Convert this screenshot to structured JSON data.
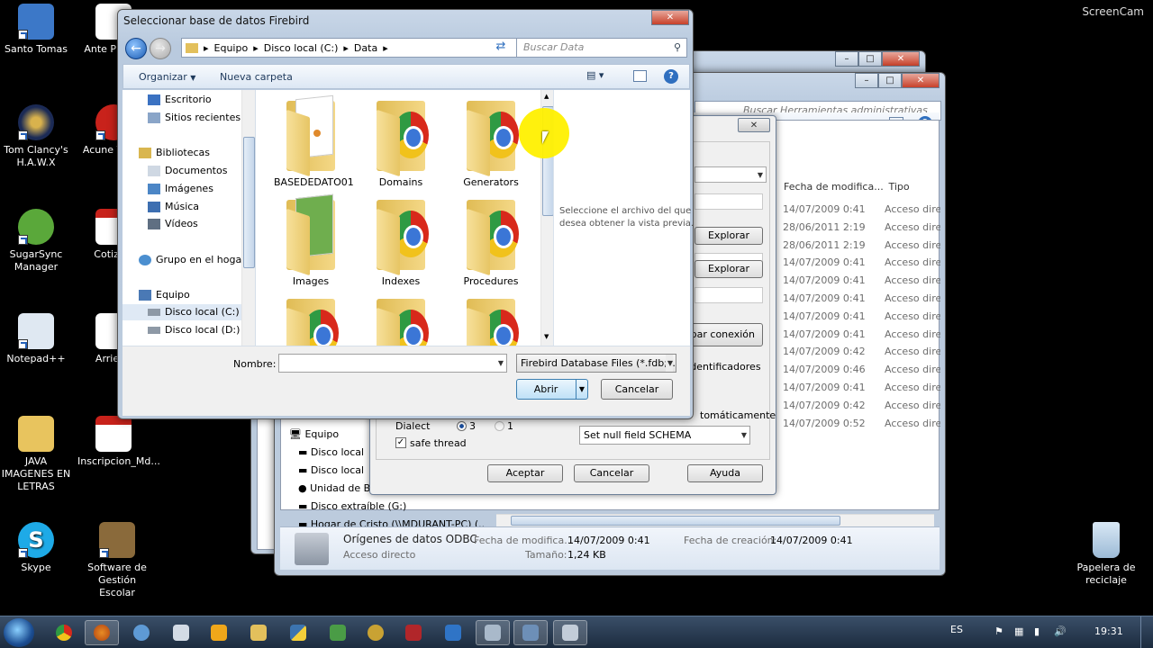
{
  "desktop": {
    "icons": [
      {
        "label": "Santo Tomas",
        "icon": "computer-icon",
        "color": "#3c78c8"
      },
      {
        "label": "Tom Clancy's H.A.W.X",
        "icon": "game-icon",
        "color": "#1b2a55"
      },
      {
        "label": "SugarSync Manager",
        "icon": "sugarsync-icon",
        "color": "#5aa83a"
      },
      {
        "label": "Notepad++",
        "icon": "notepad-icon",
        "color": "#dfe8f2"
      },
      {
        "label": "JAVA IMAGENES EN LETRAS",
        "icon": "folder-icon",
        "color": "#e8c45e"
      },
      {
        "label": "Skype",
        "icon": "skype-icon",
        "color": "#1eaae7"
      },
      {
        "label": "Ante P Tesis",
        "icon": "document-icon",
        "color": "#ffffff"
      },
      {
        "label": "Acune Vulne",
        "icon": "app-icon",
        "color": "#c8221b"
      },
      {
        "label": "Cotizaci",
        "icon": "pdf-icon",
        "color": "#c8221b"
      },
      {
        "label": "Arriend",
        "icon": "document-icon",
        "color": "#ffffff"
      },
      {
        "label": "Inscripcion_Md...",
        "icon": "pdf-icon",
        "color": "#c8221b"
      },
      {
        "label": "Software de Gestión Escolar",
        "icon": "school-icon",
        "color": "#8a6a3b"
      },
      {
        "label": "Papelera de reciclaje",
        "icon": "recycle-bin-icon",
        "color": "#b9d3ea"
      }
    ],
    "screencam": "ScreenCam"
  },
  "back_explorer": {
    "search_placeholder": "Buscar Herramientas administrativas",
    "columns": [
      "Fecha de modifica...",
      "Tipo"
    ],
    "rows": [
      {
        "date": "14/07/2009 0:41",
        "type": "Acceso direc"
      },
      {
        "date": "28/06/2011 2:19",
        "type": "Acceso direc"
      },
      {
        "date": "28/06/2011 2:19",
        "type": "Acceso direc"
      },
      {
        "date": "14/07/2009 0:41",
        "type": "Acceso direc"
      },
      {
        "date": "14/07/2009 0:41",
        "type": "Acceso direc"
      },
      {
        "date": "14/07/2009 0:41",
        "type": "Acceso direc"
      },
      {
        "date": "14/07/2009 0:41",
        "type": "Acceso direc"
      },
      {
        "date": "14/07/2009 0:41",
        "type": "Acceso direc"
      },
      {
        "date": "14/07/2009 0:42",
        "type": "Acceso direc"
      },
      {
        "date": "14/07/2009 0:46",
        "type": "Acceso direc"
      },
      {
        "date": "14/07/2009 0:41",
        "type": "Acceso direc"
      },
      {
        "date": "14/07/2009 0:42",
        "type": "Acceso direc"
      },
      {
        "date": "14/07/2009 0:52",
        "type": "Acceso direc"
      }
    ],
    "nav": [
      "Equipo",
      "Disco local",
      "Disco local",
      "Unidad de B",
      "Disco extraíble (G:)",
      "Hogar de Cristo (\\\\MDURANT-PC) (..."
    ],
    "details": {
      "name": "Orígenes de datos ODBC",
      "mod_label": "Fecha de modifica...",
      "mod_value": "14/07/2009 0:41",
      "created_label": "Fecha de creación:",
      "created_value": "14/07/2009 0:41",
      "type": "Acceso directo",
      "size_label": "Tamaño:",
      "size_value": "1,24 KB"
    }
  },
  "cfg_dialog": {
    "explore1": "Explorar",
    "explore2": "Explorar",
    "test_conn": "bar conexión",
    "quoted_ids": "Identificadores",
    "auto": "tomáticamente",
    "dialect_label": "Dialect",
    "dialect_3": "3",
    "dialect_1": "1",
    "safe_thread": "safe thread",
    "null_field": "Set null field SCHEMA",
    "ok": "Aceptar",
    "cancel": "Cancelar",
    "help": "Ayuda"
  },
  "file_dialog": {
    "title": "Seleccionar base de datos Firebird",
    "breadcrumb": [
      "Equipo",
      "Disco local (C:)",
      "Data"
    ],
    "search_placeholder": "Buscar Data",
    "organize": "Organizar",
    "new_folder": "Nueva carpeta",
    "nav": {
      "favorites": [
        "Escritorio",
        "Sitios recientes"
      ],
      "libraries_title": "Bibliotecas",
      "libraries": [
        "Documentos",
        "Imágenes",
        "Música",
        "Vídeos"
      ],
      "homegroup": "Grupo en el hogar",
      "computer_title": "Equipo",
      "drives": [
        "Disco local (C:)",
        "Disco local (D:)"
      ]
    },
    "folders": [
      "BASEDEDATO01",
      "Domains",
      "Generators",
      "Images",
      "Indexes",
      "Procedures"
    ],
    "preview_text": "Seleccione el archivo del que desea obtener la vista previa.",
    "filename_label": "Nombre:",
    "filename_value": "",
    "filter": "Firebird Database Files (*.fdb;*.g",
    "open": "Abrir",
    "cancel": "Cancelar"
  },
  "taskbar": {
    "language": "ES",
    "time": "19:31"
  }
}
